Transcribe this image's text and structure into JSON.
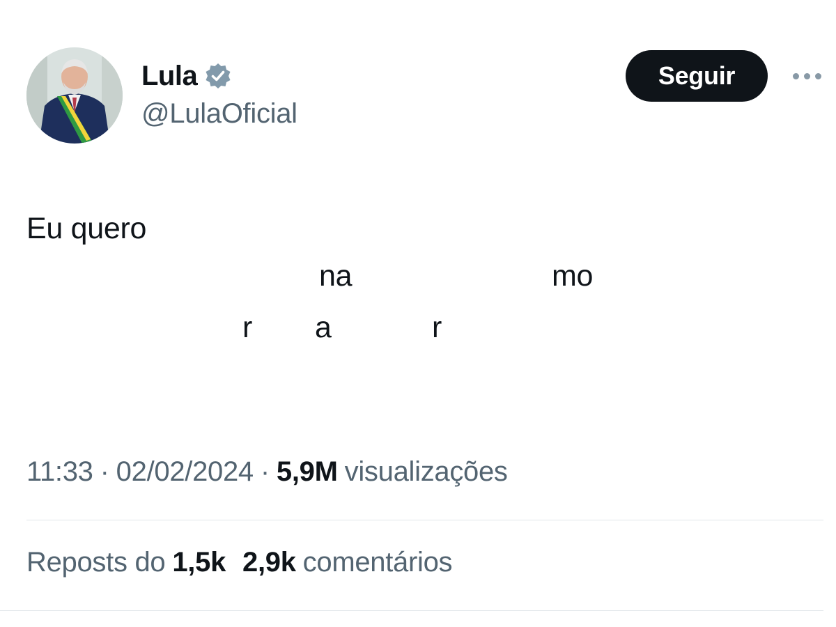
{
  "author": {
    "display_name": "Lula",
    "handle": "@LulaOficial",
    "verified": true,
    "avatar_icon": "profile-photo"
  },
  "follow_button": {
    "label": "Seguir"
  },
  "more_button": {
    "icon": "more-horizontal-icon"
  },
  "tweet": {
    "text_visible": "Eu quero",
    "fragments": {
      "na": "na",
      "mo": "mo",
      "r1": "r",
      "a": "a",
      "r2": "r"
    }
  },
  "meta": {
    "time": "11:33",
    "separator": "·",
    "date": "02/02/2024",
    "views_count": "5,9M",
    "views_label": "visualizações"
  },
  "stats": {
    "reposts_label": "Reposts do",
    "reposts_count": "1,5k",
    "comments_count": "2,9k",
    "comments_label": "comentários"
  },
  "colors": {
    "text_primary": "#0f1419",
    "text_secondary": "#536471",
    "verified_badge": "#829aab",
    "button_bg": "#0f1419",
    "divider": "#e1e6ea"
  }
}
